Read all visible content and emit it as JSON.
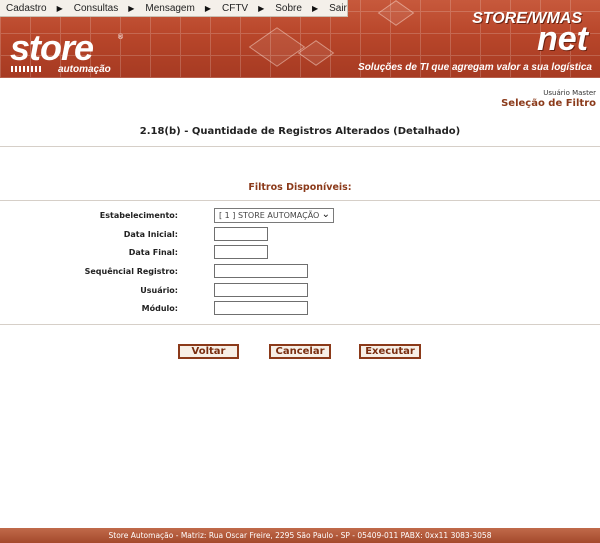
{
  "menu": {
    "items": [
      {
        "label": "Cadastro"
      },
      {
        "label": "Consultas"
      },
      {
        "label": "Mensagem"
      },
      {
        "label": "CFTV"
      },
      {
        "label": "Sobre"
      },
      {
        "label": "Sair"
      }
    ]
  },
  "header": {
    "logo_text": "store",
    "logo_sub": "automação",
    "logo_reg": "®",
    "brand": "STORE/WMAS",
    "brand_net": "net",
    "tagline": "Soluções de TI que agregam valor a sua logística"
  },
  "user": {
    "name": "Usuário Master"
  },
  "page": {
    "title": "Seleção de Filtro",
    "report_title": "2.18(b) - Quantidade de Registros Alterados (Detalhado)"
  },
  "filters": {
    "heading": "Filtros Disponíveis:",
    "estabelecimento": {
      "label": "Estabelecimento:",
      "value": "[ 1 ] STORE AUTOMAÇÃO"
    },
    "data_inicial": {
      "label": "Data Inicial:",
      "value": ""
    },
    "data_final": {
      "label": "Data Final:",
      "value": ""
    },
    "sequencial": {
      "label": "Sequêncial Registro:",
      "value": ""
    },
    "usuario": {
      "label": "Usuário:",
      "value": ""
    },
    "modulo": {
      "label": "Módulo:",
      "value": ""
    }
  },
  "buttons": {
    "voltar": "Voltar",
    "cancelar": "Cancelar",
    "executar": "Executar"
  },
  "footer": {
    "text": "Store Automação - Matriz: Rua Oscar Freire, 2295 São Paulo - SP - 05409-011 PABX: 0xx11 3083-3058"
  }
}
